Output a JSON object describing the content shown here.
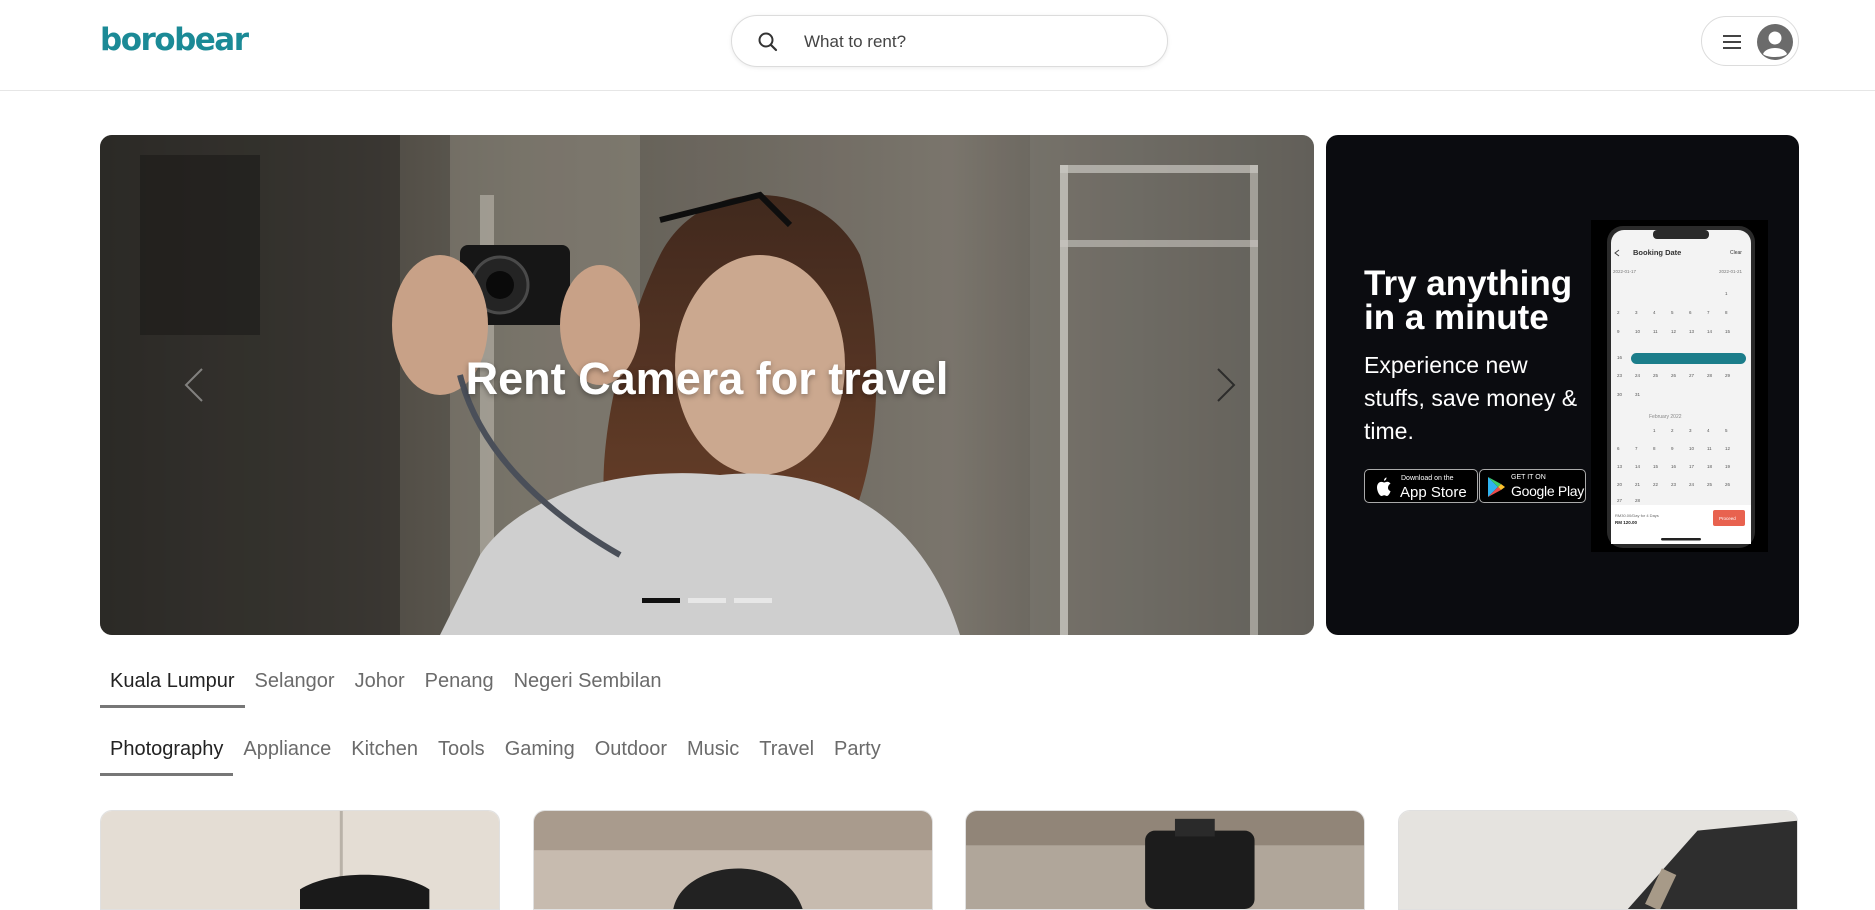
{
  "header": {
    "logo": "borobear",
    "search_placeholder": "What to rent?",
    "icons": [
      "search-icon",
      "hamburger-menu-icon",
      "user-avatar-icon"
    ]
  },
  "hero": {
    "title": "Rent Camera for travel",
    "slides_total": 3,
    "active_slide": 1
  },
  "promo": {
    "heading": "Try anything in a minute",
    "body": "Experience new stuffs, save money & time.",
    "app_store_small": "Download on the",
    "app_store_large": "App Store",
    "google_play_small": "GET IT ON",
    "google_play_large": "Google Play",
    "phone": {
      "screen_title": "Booking Date",
      "clear_label": "Clear",
      "start_date": "2022-01-17",
      "end_date": "2022-01-21",
      "month_label": "February 2022",
      "footer_note": "RM30.00/Day for 4 Days",
      "footer_price": "RM 120.00",
      "proceed_label": "Proceed"
    }
  },
  "locations": {
    "tabs": [
      "Kuala Lumpur",
      "Selangor",
      "Johor",
      "Penang",
      "Negeri Sembilan"
    ],
    "active": "Kuala Lumpur"
  },
  "categories": {
    "tabs": [
      "Photography",
      "Appliance",
      "Kitchen",
      "Tools",
      "Gaming",
      "Outdoor",
      "Music",
      "Travel",
      "Party"
    ],
    "active": "Photography"
  },
  "colors": {
    "brand": "#1b8a96",
    "promo_bg": "#0b0c10",
    "proceed": "#e8624f"
  }
}
